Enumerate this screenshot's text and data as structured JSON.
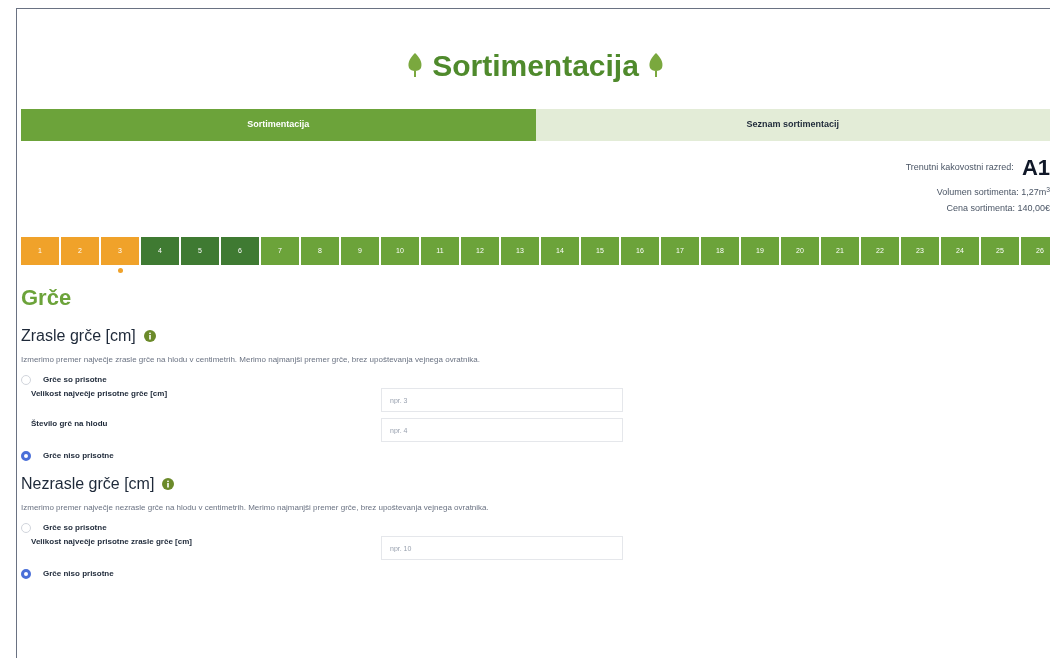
{
  "title": "Sortimentacija",
  "tabs": [
    {
      "label": "Sortimentacija",
      "selected": true
    },
    {
      "label": "Seznam sortimentacij",
      "selected": false
    }
  ],
  "summary": {
    "class_label": "Trenutni kakovostni razred:",
    "class_value": "A1",
    "volume": "Volumen sortimenta: 1,27m$^{3}$",
    "price": "Cena sortimenta: 140,00€"
  },
  "steps": [
    {
      "label": "1",
      "color": "#f0a22a",
      "selected": false
    },
    {
      "label": "2",
      "color": "#f0a22a",
      "selected": false
    },
    {
      "label": "3",
      "color": "#f0a22a",
      "selected": true
    },
    {
      "label": "4",
      "color": "#3f7a32",
      "selected": false
    },
    {
      "label": "5",
      "color": "#3f7a32",
      "selected": false
    },
    {
      "label": "6",
      "color": "#3f7a32",
      "selected": false
    },
    {
      "label": "7",
      "color": "#6ca33a",
      "selected": false
    },
    {
      "label": "8",
      "color": "#6ca33a",
      "selected": false
    },
    {
      "label": "9",
      "color": "#6ca33a",
      "selected": false
    },
    {
      "label": "10",
      "color": "#6ca33a",
      "selected": false
    },
    {
      "label": "11",
      "color": "#6ca33a",
      "selected": false
    },
    {
      "label": "12",
      "color": "#6ca33a",
      "selected": false
    },
    {
      "label": "13",
      "color": "#6ca33a",
      "selected": false
    },
    {
      "label": "14",
      "color": "#6ca33a",
      "selected": false
    },
    {
      "label": "15",
      "color": "#6ca33a",
      "selected": false
    },
    {
      "label": "16",
      "color": "#6ca33a",
      "selected": false
    },
    {
      "label": "17",
      "color": "#6ca33a",
      "selected": false
    },
    {
      "label": "18",
      "color": "#6ca33a",
      "selected": false
    },
    {
      "label": "19",
      "color": "#6ca33a",
      "selected": false
    },
    {
      "label": "20",
      "color": "#6ca33a",
      "selected": false
    },
    {
      "label": "21",
      "color": "#6ca33a",
      "selected": false
    },
    {
      "label": "22",
      "color": "#6ca33a",
      "selected": false
    },
    {
      "label": "23",
      "color": "#6ca33a",
      "selected": false
    },
    {
      "label": "24",
      "color": "#6ca33a",
      "selected": false
    },
    {
      "label": "25",
      "color": "#6ca33a",
      "selected": false
    },
    {
      "label": "26",
      "color": "#6ca33a",
      "selected": false
    }
  ],
  "heading": "Grče",
  "sections": [
    {
      "title": "Zrasle grče [cm]",
      "description": "Izmerimo premer največje zrasle grče na hlodu v centimetrih. Merimo najmanjši premer grče, brez upoštevanja vejnega ovratnika.",
      "options": [
        {
          "label": "Grče so prisotne",
          "selected": false,
          "fields": [
            {
              "label": "Velikost največje prisotne grče [cm]",
              "placeholder": "npr. 3"
            },
            {
              "label": "Število grč na hlodu",
              "placeholder": "npr. 4"
            }
          ]
        },
        {
          "label": "Grče niso prisotne",
          "selected": true
        }
      ]
    },
    {
      "title": "Nezrasle grče [cm]",
      "description": "Izmerimo premer največje nezrasle grče na hlodu v centimetrih. Merimo najmanjši premer grče, brez upoštevanja vejnega ovratnika.",
      "options": [
        {
          "label": "Grče so prisotne",
          "selected": false,
          "fields": [
            {
              "label": "Velikost največje prisotne zrasle grče [cm]",
              "placeholder": "npr. 10"
            }
          ]
        },
        {
          "label": "Grče niso prisotne",
          "selected": true
        }
      ]
    }
  ]
}
